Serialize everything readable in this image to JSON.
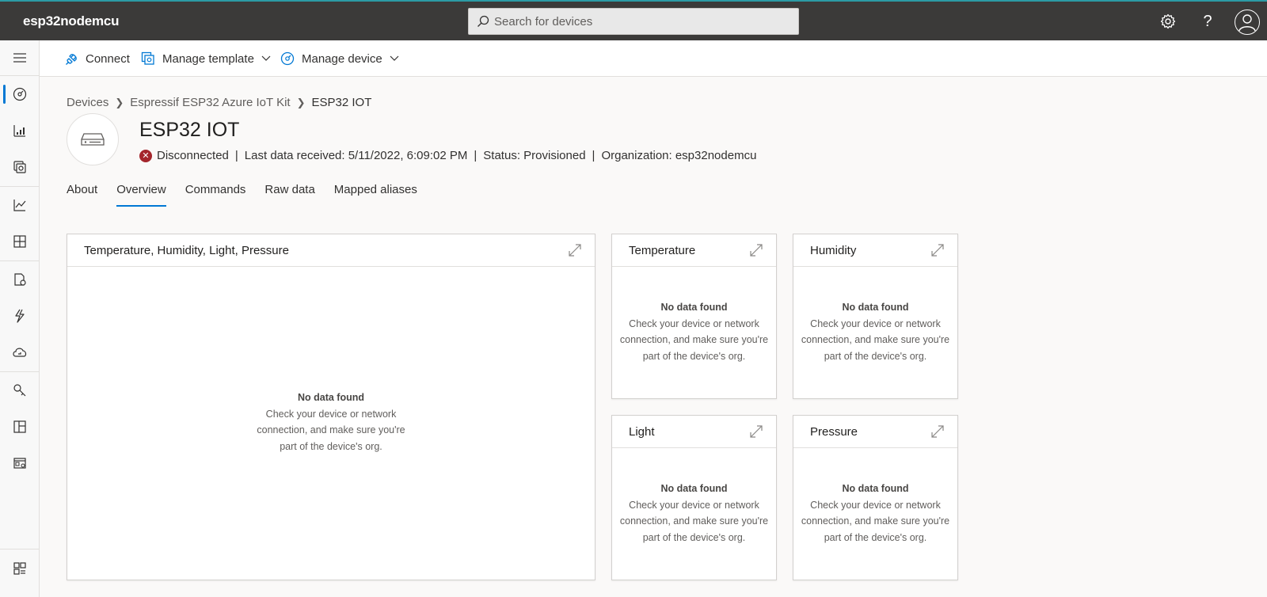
{
  "header": {
    "app_name": "esp32nodemcu",
    "search_placeholder": "Search for devices",
    "help_label": "?"
  },
  "commandbar": {
    "connect": "Connect",
    "manage_template": "Manage template",
    "manage_device": "Manage device"
  },
  "breadcrumb": {
    "items": [
      "Devices",
      "Espressif ESP32 Azure IoT Kit",
      "ESP32 IOT"
    ]
  },
  "device": {
    "name": "ESP32 IOT",
    "connection": "Disconnected",
    "last_data": "Last data received: 5/11/2022, 6:09:02 PM",
    "status": "Status: Provisioned",
    "organization": "Organization: esp32nodemcu",
    "separator": "|"
  },
  "tabs": [
    {
      "label": "About",
      "active": false
    },
    {
      "label": "Overview",
      "active": true
    },
    {
      "label": "Commands",
      "active": false
    },
    {
      "label": "Raw data",
      "active": false
    },
    {
      "label": "Mapped aliases",
      "active": false
    }
  ],
  "tiles": [
    {
      "title": "Temperature, Humidity, Light, Pressure",
      "empty_title": "No data found",
      "empty_message": "Check your device or network connection, and make sure you're part of the device's org."
    },
    {
      "title": "Temperature",
      "empty_title": "No data found",
      "empty_message": "Check your device or network connection, and make sure you're part of the device's org."
    },
    {
      "title": "Humidity",
      "empty_title": "No data found",
      "empty_message": "Check your device or network connection, and make sure you're part of the device's org."
    },
    {
      "title": "Light",
      "empty_title": "No data found",
      "empty_message": "Check your device or network connection, and make sure you're part of the device's org."
    },
    {
      "title": "Pressure",
      "empty_title": "No data found",
      "empty_message": "Check your device or network connection, and make sure you're part of the device's org."
    }
  ],
  "colors": {
    "header_bg": "#3b3a39",
    "accent": "#0078d4",
    "error": "#a4262c"
  },
  "icons": {
    "rail": [
      "menu-icon",
      "dashboard-icon",
      "devices-icon",
      "device-groups-icon",
      "analytics-icon",
      "dashboards-icon",
      "device-templates-icon",
      "rules-icon",
      "data-export-icon",
      "permissions-icon",
      "app-settings-icon",
      "customization-icon",
      "iot-central-home-icon"
    ]
  }
}
